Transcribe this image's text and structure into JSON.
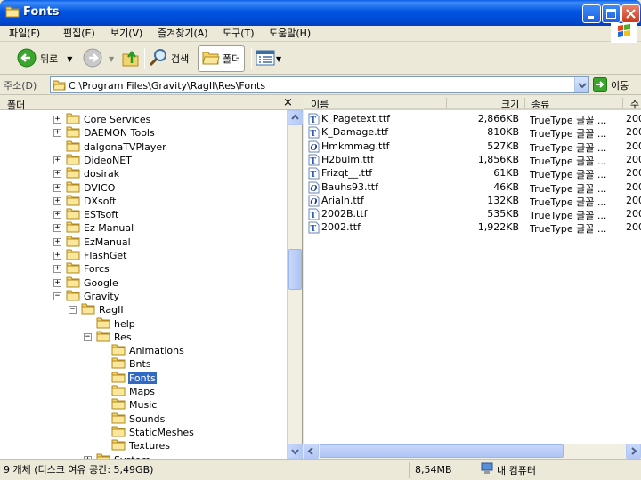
{
  "window": {
    "title": "Fonts"
  },
  "menu": [
    "파일(F)",
    "편집(E)",
    "보기(V)",
    "즐겨찾기(A)",
    "도구(T)",
    "도움말(H)"
  ],
  "toolbar": {
    "back_label": "뒤로",
    "search_label": "검색",
    "folders_label": "폴더"
  },
  "address": {
    "label": "주소(D)",
    "value": "C:\\Program Files\\Gravity\\RagII\\Res\\Fonts",
    "go_label": "이동"
  },
  "folder_pane": {
    "header": "폴더",
    "close_symbol": "×",
    "items": [
      {
        "label": "Core Services",
        "expander": "+"
      },
      {
        "label": "DAEMON Tools",
        "expander": "+"
      },
      {
        "label": "dalgonaTVPlayer",
        "expander": ""
      },
      {
        "label": "DideoNET",
        "expander": "+"
      },
      {
        "label": "dosirak",
        "expander": "+"
      },
      {
        "label": "DVICO",
        "expander": "+"
      },
      {
        "label": "DXsoft",
        "expander": "+"
      },
      {
        "label": "ESTsoft",
        "expander": "+"
      },
      {
        "label": "Ez Manual",
        "expander": "+"
      },
      {
        "label": "EzManual",
        "expander": "+"
      },
      {
        "label": "FlashGet",
        "expander": "+"
      },
      {
        "label": "Forcs",
        "expander": "+"
      },
      {
        "label": "Google",
        "expander": "+"
      },
      {
        "label": "Gravity",
        "expander": "−"
      },
      {
        "label": "RagII",
        "expander": "−"
      },
      {
        "label": "help",
        "expander": ""
      },
      {
        "label": "Res",
        "expander": "−"
      },
      {
        "label": "Animations",
        "expander": ""
      },
      {
        "label": "Bnts",
        "expander": ""
      },
      {
        "label": "Fonts",
        "expander": "",
        "selected": true
      },
      {
        "label": "Maps",
        "expander": ""
      },
      {
        "label": "Music",
        "expander": ""
      },
      {
        "label": "Sounds",
        "expander": ""
      },
      {
        "label": "StaticMeshes",
        "expander": ""
      },
      {
        "label": "Textures",
        "expander": ""
      },
      {
        "label": "System",
        "expander": "+"
      }
    ]
  },
  "file_list": {
    "columns": [
      "이름",
      "크기",
      "종류",
      "수"
    ],
    "rows": [
      {
        "name": "K_Pagetext.ttf",
        "size": "2,866KB",
        "type": "TrueType 글꼴 ...",
        "date": "200",
        "icon": "truetype"
      },
      {
        "name": "K_Damage.ttf",
        "size": "810KB",
        "type": "TrueType 글꼴 ...",
        "date": "200",
        "icon": "truetype"
      },
      {
        "name": "Hmkmmag.ttf",
        "size": "527KB",
        "type": "TrueType 글꼴 ...",
        "date": "200",
        "icon": "opentype"
      },
      {
        "name": "H2bulm.ttf",
        "size": "1,856KB",
        "type": "TrueType 글꼴 ...",
        "date": "200",
        "icon": "truetype"
      },
      {
        "name": "Frizqt__.ttf",
        "size": "61KB",
        "type": "TrueType 글꼴 ...",
        "date": "200",
        "icon": "truetype"
      },
      {
        "name": "Bauhs93.ttf",
        "size": "46KB",
        "type": "TrueType 글꼴 ...",
        "date": "200",
        "icon": "opentype"
      },
      {
        "name": "Arialn.ttf",
        "size": "132KB",
        "type": "TrueType 글꼴 ...",
        "date": "200",
        "icon": "opentype"
      },
      {
        "name": "2002B.ttf",
        "size": "535KB",
        "type": "TrueType 글꼴 ...",
        "date": "200",
        "icon": "truetype"
      },
      {
        "name": "2002.ttf",
        "size": "1,922KB",
        "type": "TrueType 글꼴 ...",
        "date": "200",
        "icon": "truetype"
      }
    ]
  },
  "status": {
    "objects": "9 개체 (디스크 여유 공간: 5,49GB)",
    "size": "8,54MB",
    "location": "내 컴퓨터"
  }
}
